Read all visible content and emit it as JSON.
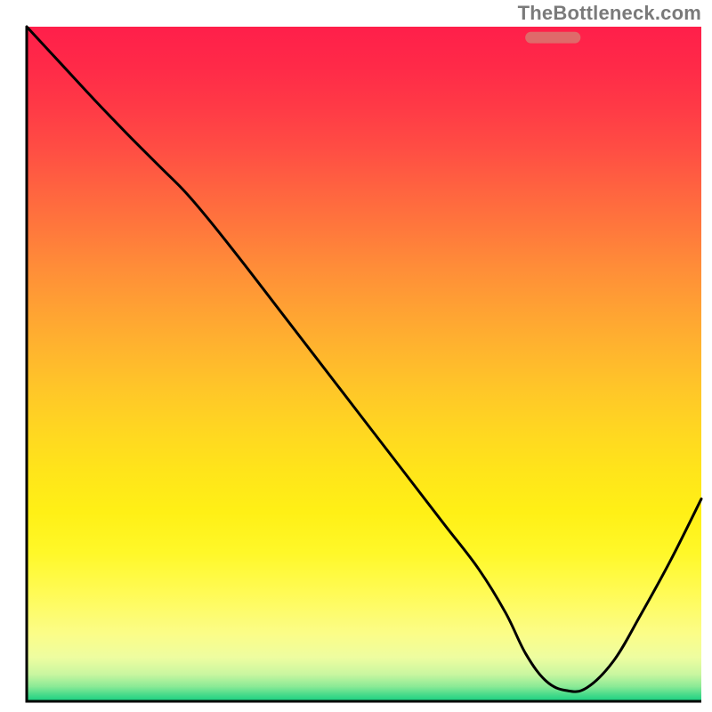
{
  "watermark": "TheBottleneck.com",
  "gradient": {
    "stops": [
      {
        "offset": 0.0,
        "color": "#ff1f4a"
      },
      {
        "offset": 0.06,
        "color": "#ff2a48"
      },
      {
        "offset": 0.12,
        "color": "#ff3a46"
      },
      {
        "offset": 0.18,
        "color": "#ff4d44"
      },
      {
        "offset": 0.24,
        "color": "#ff6340"
      },
      {
        "offset": 0.3,
        "color": "#ff783c"
      },
      {
        "offset": 0.36,
        "color": "#ff8e38"
      },
      {
        "offset": 0.42,
        "color": "#ffa233"
      },
      {
        "offset": 0.48,
        "color": "#ffb52e"
      },
      {
        "offset": 0.54,
        "color": "#ffc728"
      },
      {
        "offset": 0.6,
        "color": "#ffd721"
      },
      {
        "offset": 0.66,
        "color": "#ffe51a"
      },
      {
        "offset": 0.72,
        "color": "#fff016"
      },
      {
        "offset": 0.78,
        "color": "#fff829"
      },
      {
        "offset": 0.84,
        "color": "#fffb56"
      },
      {
        "offset": 0.9,
        "color": "#fbfd88"
      },
      {
        "offset": 0.935,
        "color": "#eefda0"
      },
      {
        "offset": 0.96,
        "color": "#c9f6a0"
      },
      {
        "offset": 0.978,
        "color": "#8bea96"
      },
      {
        "offset": 0.99,
        "color": "#48db8b"
      },
      {
        "offset": 1.0,
        "color": "#17cf80"
      }
    ]
  },
  "marker": {
    "x_center": 0.78,
    "y": 0.984,
    "width": 0.082,
    "height": 0.017,
    "rx": 0.0085,
    "color": "#df6a6a"
  },
  "chart_data": {
    "type": "line",
    "title": "",
    "xlabel": "",
    "ylabel": "",
    "xlim": [
      0,
      1
    ],
    "ylim": [
      0,
      1
    ],
    "grid": false,
    "legend": false,
    "axes_visible": false,
    "annotations": [
      {
        "text": "TheBottleneck.com",
        "pos": "top-right"
      }
    ],
    "background_gradient": "red-orange-yellow-green (top to bottom)",
    "optimum_marker": {
      "x_range": [
        0.739,
        0.821
      ],
      "y": 0.016
    },
    "series": [
      {
        "name": "bottleneck-curve",
        "x": [
          0.0,
          0.05,
          0.1,
          0.15,
          0.2,
          0.235,
          0.27,
          0.32,
          0.37,
          0.42,
          0.47,
          0.52,
          0.57,
          0.62,
          0.67,
          0.71,
          0.74,
          0.77,
          0.8,
          0.83,
          0.87,
          0.91,
          0.955,
          1.0
        ],
        "values": [
          1.0,
          0.946,
          0.892,
          0.84,
          0.79,
          0.755,
          0.714,
          0.651,
          0.586,
          0.521,
          0.456,
          0.391,
          0.326,
          0.261,
          0.196,
          0.131,
          0.07,
          0.03,
          0.016,
          0.02,
          0.06,
          0.128,
          0.21,
          0.3
        ]
      }
    ]
  }
}
